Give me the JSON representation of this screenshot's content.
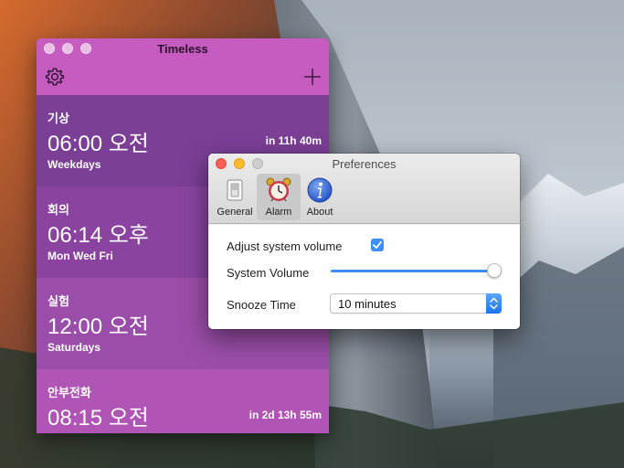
{
  "timeless": {
    "title": "Timeless",
    "toolbar": {
      "settings_icon": "gear-icon",
      "add_icon": "plus-icon"
    },
    "alarms": [
      {
        "name": "기상",
        "time": "06:00 오전",
        "days": "Weekdays",
        "remaining": "in 11h 40m",
        "color": "#7b3f96"
      },
      {
        "name": "회의",
        "time": "06:14 오후",
        "days": "Mon Wed Fri",
        "remaining": "",
        "color": "#8a44a0"
      },
      {
        "name": "실험",
        "time": "12:00 오전",
        "days": "Saturdays",
        "remaining": "",
        "color": "#9b4ea9"
      },
      {
        "name": "안부전화",
        "time": "08:15 오전",
        "days": "",
        "remaining": "in 2d 13h 55m",
        "color": "#b054b5"
      }
    ]
  },
  "preferences": {
    "title": "Preferences",
    "tabs": [
      {
        "label": "General",
        "icon": "switch-icon",
        "selected": false
      },
      {
        "label": "Alarm",
        "icon": "alarm-clock-icon",
        "selected": true
      },
      {
        "label": "About",
        "icon": "info-icon",
        "selected": false
      }
    ],
    "adjust_volume_label": "Adjust system volume",
    "adjust_volume_checked": true,
    "system_volume_label": "System Volume",
    "system_volume_level": 1.0,
    "snooze_label": "Snooze Time",
    "snooze_value": "10 minutes",
    "accent_color": "#3d8ff7"
  }
}
